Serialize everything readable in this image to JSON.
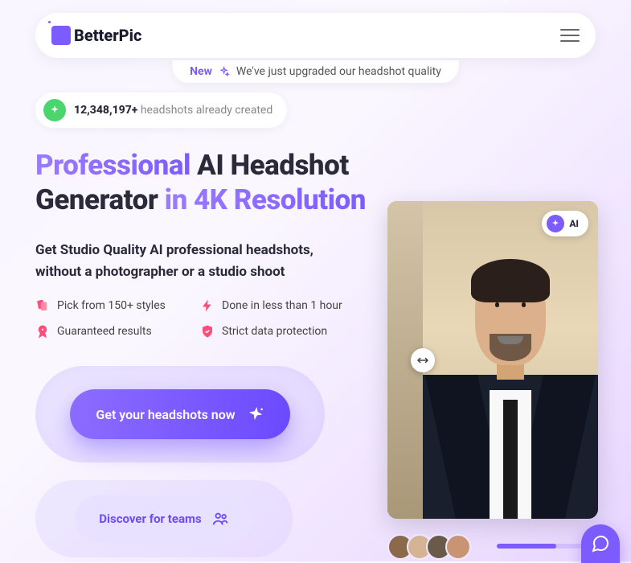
{
  "brand": {
    "name": "BetterPic"
  },
  "newBadge": {
    "label": "New",
    "text": "We've just upgraded our headshot quality"
  },
  "counter": {
    "count": "12,348,197+",
    "text": "headshots already created"
  },
  "headline": {
    "p1": "Professional",
    "p2": " AI Headshot Generator ",
    "p3": "in 4K Resolution"
  },
  "subheadline": "Get Studio Quality AI professional headshots, without a photographer or a studio shoot",
  "features": {
    "f1": "Pick from 150+ styles",
    "f2": "Done in less than 1 hour",
    "f3": "Guaranteed results",
    "f4": "Strict data protection"
  },
  "cta": {
    "primary": "Get your headshots now",
    "secondary": "Discover for teams"
  },
  "imageCard": {
    "badge": "AI"
  },
  "colors": {
    "accent": "#7c5cff"
  }
}
